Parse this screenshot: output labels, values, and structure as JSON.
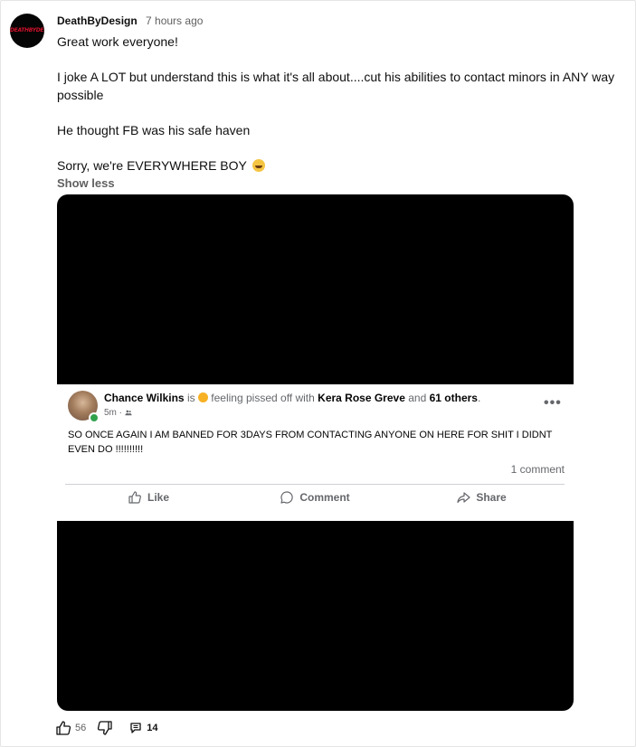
{
  "comment": {
    "author": "DeathByDesign",
    "time": "7 hours ago",
    "avatar_text": "DEATHBYDESIGN",
    "paragraphs": [
      "Great work everyone!",
      "I joke A LOT but understand this is what it's all about....cut his abilities to contact minors in ANY way possible",
      "He thought FB was his safe haven",
      "Sorry, we're EVERYWHERE BOY"
    ],
    "show_less": "Show less",
    "likes": "56",
    "replies": "14"
  },
  "fb_post": {
    "name": "Chance Wilkins",
    "is": "is",
    "feeling": "feeling pissed off with",
    "tagged": "Kera Rose Greve",
    "and": "and",
    "others": "61 others",
    "time": "5m ·",
    "text": "SO ONCE AGAIN I AM BANNED FOR 3DAYS FROM CONTACTING ANYONE ON HERE FOR SHIT I DIDNT EVEN DO  !!!!!!!!!!",
    "comment_count": "1 comment",
    "like_label": "Like",
    "comment_label": "Comment",
    "share_label": "Share",
    "more": "•••"
  },
  "icons": {
    "like": "thumbs-up-icon",
    "dislike": "thumbs-down-icon",
    "reply": "comment-icon",
    "fb_like": "thumbs-up-outline-icon",
    "fb_comment": "speech-bubble-icon",
    "fb_share": "share-arrow-icon",
    "more": "ellipsis-icon"
  },
  "colors": {
    "fb_text_secondary": "#65676b",
    "online": "#31a24c",
    "logo": "#d0112b"
  }
}
